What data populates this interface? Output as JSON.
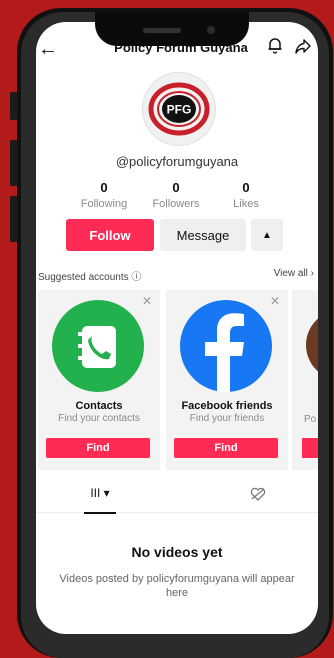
{
  "header": {
    "title": "Policy Forum Guyana"
  },
  "profile": {
    "avatar_text": "PFG",
    "username": "@policyforumguyana",
    "stats": [
      {
        "value": "0",
        "label": "Following"
      },
      {
        "value": "0",
        "label": "Followers"
      },
      {
        "value": "0",
        "label": "Likes"
      }
    ]
  },
  "actions": {
    "follow": "Follow",
    "message": "Message",
    "more": "▲"
  },
  "suggested": {
    "label": "Suggested accounts ⓘ",
    "view_all": "View all ›",
    "cards": [
      {
        "name": "Contacts",
        "subtitle": "Find your contacts",
        "button": "Find",
        "icon": "contacts-icon",
        "color": "#22b14c"
      },
      {
        "name": "Facebook friends",
        "subtitle": "Find your friends",
        "button": "Find",
        "icon": "facebook-icon",
        "color": "#1877f2"
      }
    ],
    "partial_subtitle": "Po"
  },
  "tabs": {
    "videos": "III ▾"
  },
  "empty": {
    "title": "No videos yet",
    "subtitle": "Videos posted by policyforumguyana will appear here"
  },
  "colors": {
    "accent": "#fe2c55",
    "background": "#b31b1b"
  }
}
